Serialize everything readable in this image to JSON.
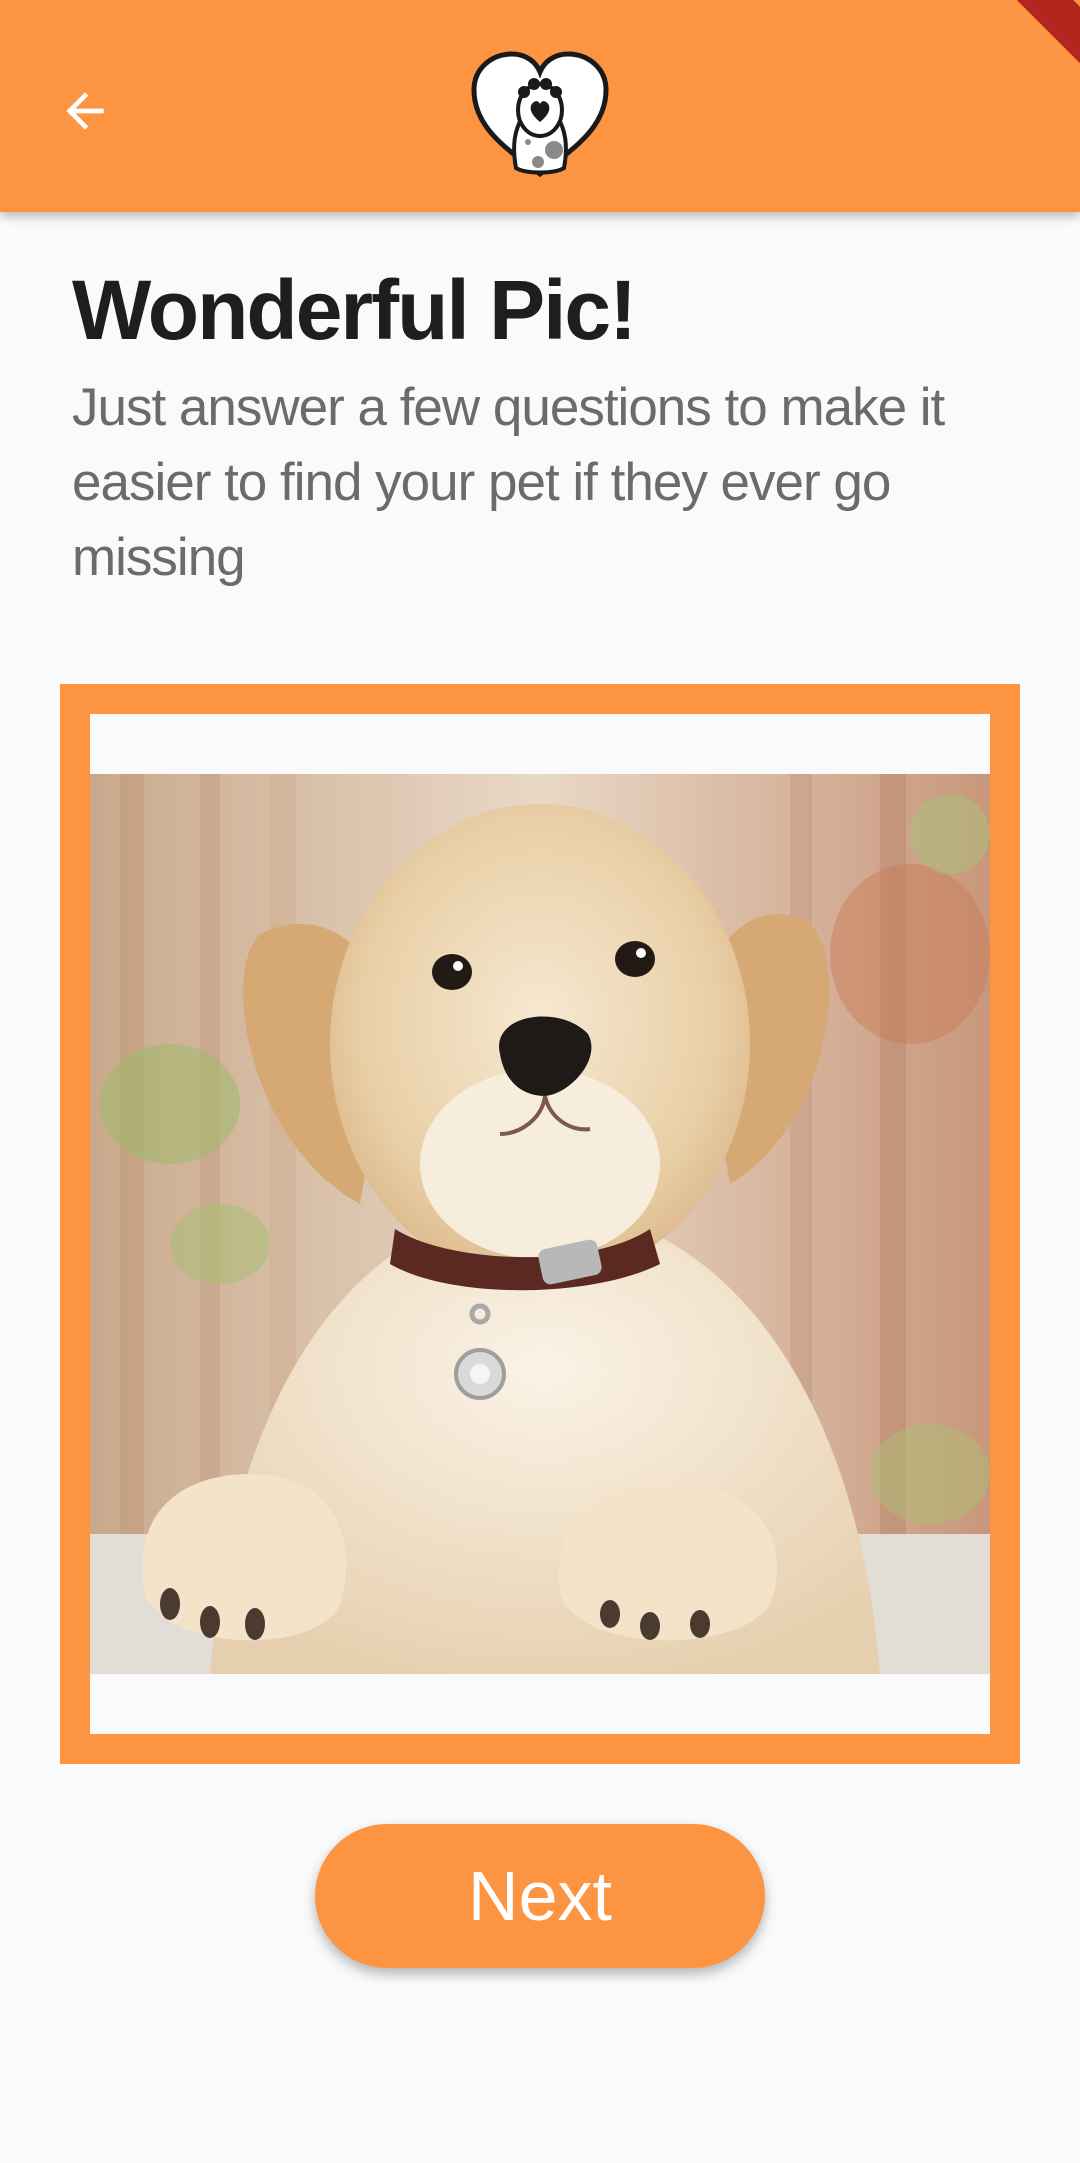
{
  "appbar": {
    "back_icon": "arrow-left-icon",
    "logo_icon": "heart-paw-logo-icon",
    "background_color": "#fd9441"
  },
  "content": {
    "title": "Wonderful Pic!",
    "subtitle": "Just answer a few questions to make it easier to find your pet if they ever go missing"
  },
  "photo": {
    "subject": "golden retriever puppy with collar and tag",
    "frame_color": "#fd9441"
  },
  "actions": {
    "next_label": "Next"
  }
}
